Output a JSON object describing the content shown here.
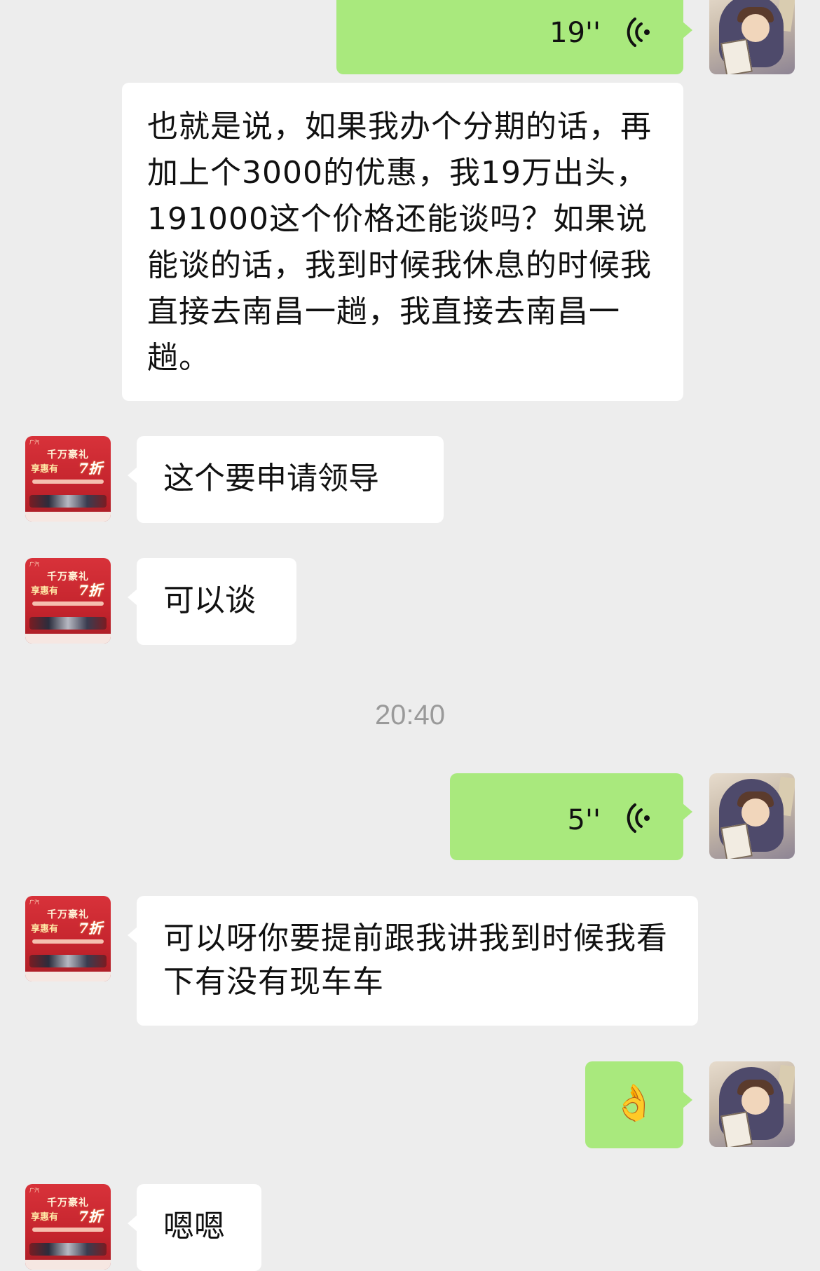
{
  "chat": {
    "messages": [
      {
        "id": "m1",
        "from": "me",
        "type": "voice",
        "duration": "19''"
      },
      {
        "id": "m2",
        "from": "me",
        "type": "text",
        "style": "voice-to-text",
        "text": "也就是说，如果我办个分期的话，再加上个3000的优惠，我19万出头，191000这个价格还能谈吗？如果说能谈的话，我到时候我休息的时候我直接去南昌一趟，我直接去南昌一趟。"
      },
      {
        "id": "m3",
        "from": "dealer",
        "type": "text",
        "text": "这个要申请领导"
      },
      {
        "id": "m4",
        "from": "dealer",
        "type": "text",
        "text": "可以谈"
      },
      {
        "id": "ts1",
        "type": "timestamp",
        "text": "20:40"
      },
      {
        "id": "m5",
        "from": "me",
        "type": "voice",
        "duration": "5''"
      },
      {
        "id": "m6",
        "from": "dealer",
        "type": "text",
        "text": "可以呀你要提前跟我讲我到时候我看下有没有现车车"
      },
      {
        "id": "m7",
        "from": "me",
        "type": "emoji",
        "text": "👌"
      },
      {
        "id": "m8",
        "from": "dealer",
        "type": "text",
        "text": "嗯嗯"
      }
    ]
  },
  "avatars": {
    "dealer": {
      "headline": "千万豪礼",
      "sub": "享惠有",
      "badge": "7折"
    }
  },
  "colors": {
    "background": "#ededed",
    "my_bubble": "#a9e97d",
    "their_bubble": "#ffffff",
    "timestamp_text": "#9a9a9a"
  }
}
